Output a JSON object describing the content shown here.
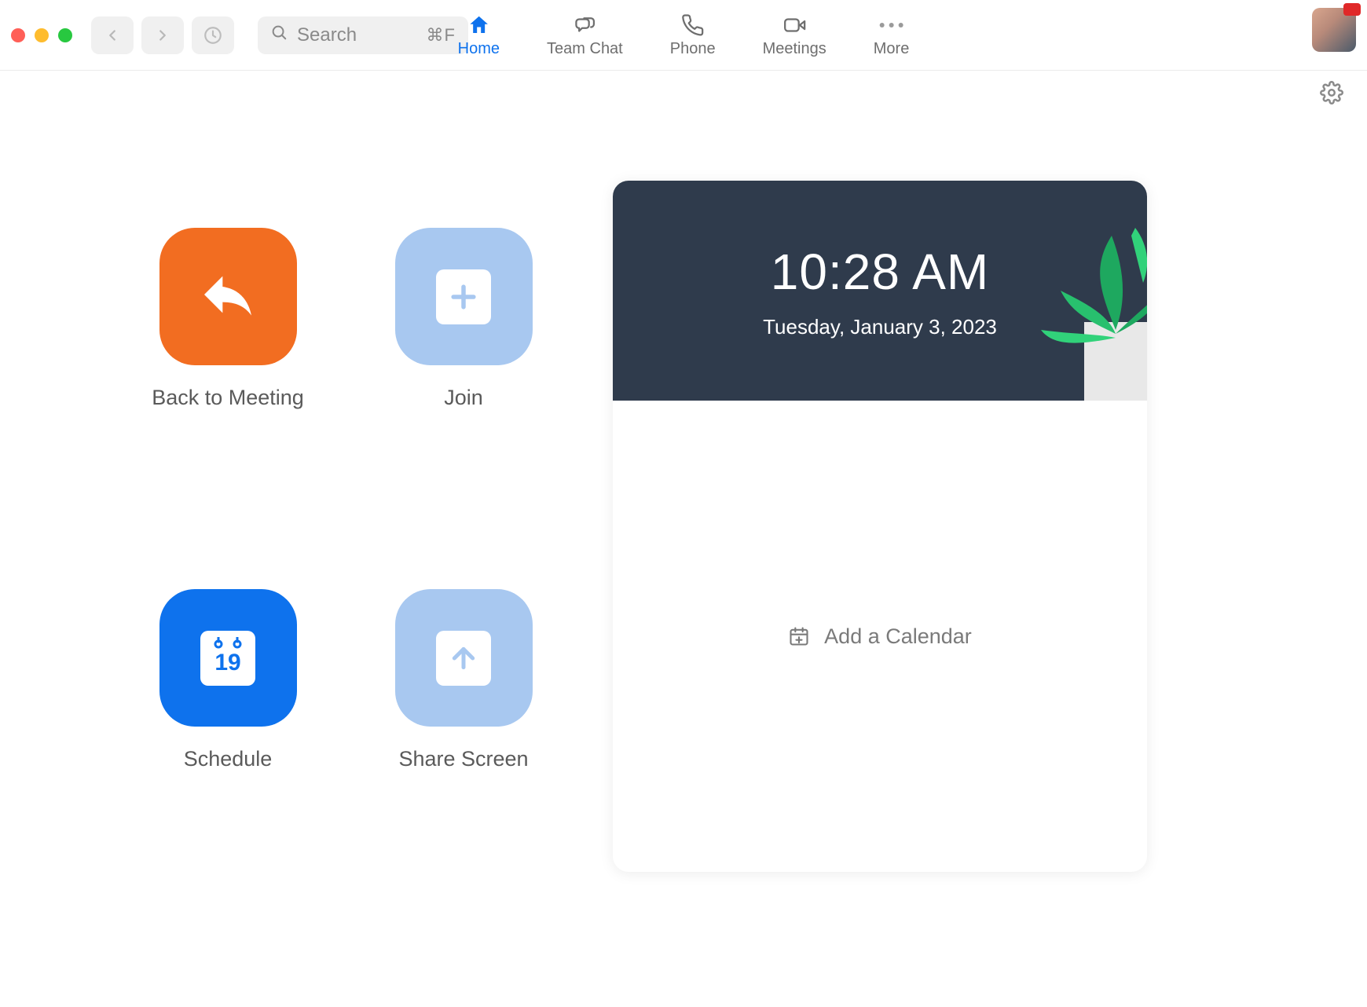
{
  "window": {
    "search_placeholder": "Search",
    "search_shortcut": "⌘F"
  },
  "tabs": [
    {
      "id": "home",
      "label": "Home",
      "active": true
    },
    {
      "id": "teamchat",
      "label": "Team Chat",
      "active": false
    },
    {
      "id": "phone",
      "label": "Phone",
      "active": false
    },
    {
      "id": "meetings",
      "label": "Meetings",
      "active": false
    },
    {
      "id": "more",
      "label": "More",
      "active": false
    }
  ],
  "actions": {
    "back_to_meeting": "Back to Meeting",
    "join": "Join",
    "schedule": "Schedule",
    "schedule_day": "19",
    "share_screen": "Share Screen"
  },
  "calendar": {
    "time": "10:28 AM",
    "date": "Tuesday, January 3, 2023",
    "add_label": "Add a Calendar"
  }
}
